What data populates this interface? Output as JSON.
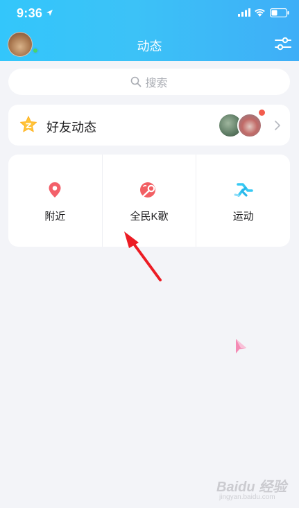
{
  "status_bar": {
    "time": "9:36"
  },
  "header": {
    "title": "动态"
  },
  "search": {
    "placeholder": "搜索"
  },
  "friends_feed": {
    "label": "好友动态"
  },
  "features": [
    {
      "label": "附近",
      "icon": "location-pin-icon",
      "color": "#f3606a"
    },
    {
      "label": "全民K歌",
      "icon": "karaoke-icon",
      "color": "#f25f63"
    },
    {
      "label": "运动",
      "icon": "running-icon",
      "color": "#36c9f4"
    }
  ],
  "colors": {
    "header_start": "#33c6fb",
    "header_end": "#3eaef7",
    "background": "#f3f4f8",
    "badge_red": "#f35c4d",
    "online_green": "#48d468",
    "star_yellow": "#ffc43b"
  },
  "watermark": {
    "brand": "Baidu 经验",
    "url": "jingyan.baidu.com"
  }
}
